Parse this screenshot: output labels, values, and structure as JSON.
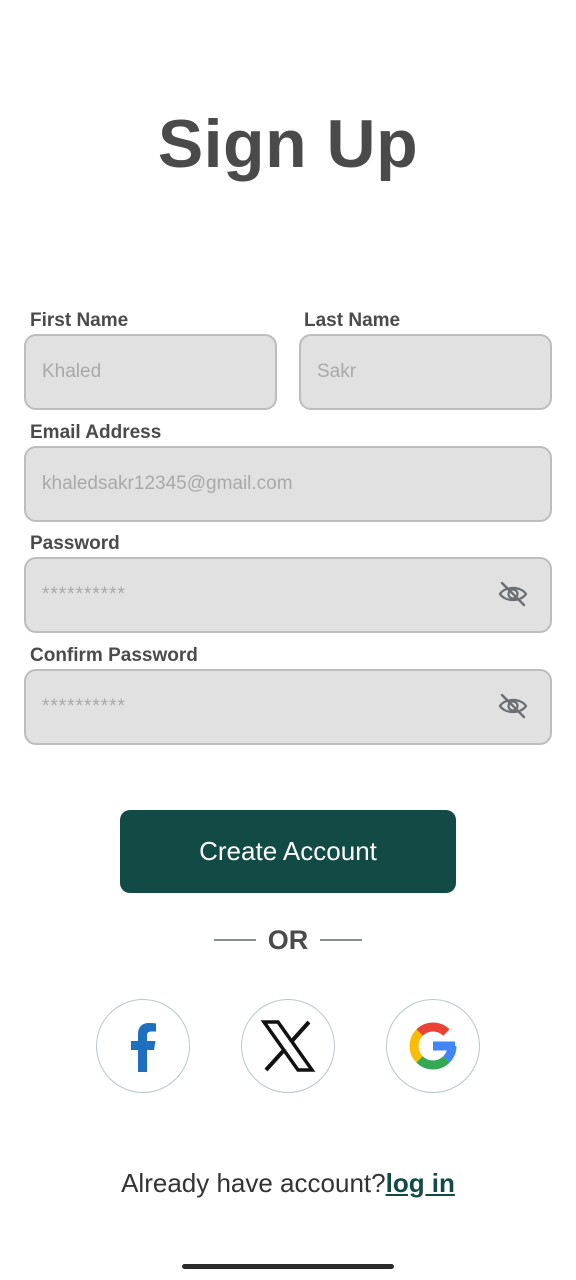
{
  "page": {
    "title": "Sign Up"
  },
  "form": {
    "first_name": {
      "label": "First Name",
      "value": "Khaled"
    },
    "last_name": {
      "label": "Last Name",
      "value": "Sakr"
    },
    "email": {
      "label": "Email Address",
      "value": "khaledsakr12345@gmail.com"
    },
    "password": {
      "label": "Password",
      "value": "**********",
      "toggle_icon": "eye-off-icon"
    },
    "confirm_password": {
      "label": "Confirm Password",
      "value": "**********",
      "toggle_icon": "eye-off-icon"
    }
  },
  "actions": {
    "create_account_label": "Create Account",
    "divider_text": "OR"
  },
  "social": [
    {
      "name": "facebook",
      "icon": "facebook-icon"
    },
    {
      "name": "x",
      "icon": "x-icon"
    },
    {
      "name": "google",
      "icon": "google-icon"
    }
  ],
  "footer": {
    "prompt": "Already have account?",
    "login_link": "log in "
  },
  "colors": {
    "primary": "#124a45",
    "field_bg": "#e1e1e1",
    "field_border": "#bdbdbd",
    "title": "#4a4a4a"
  }
}
